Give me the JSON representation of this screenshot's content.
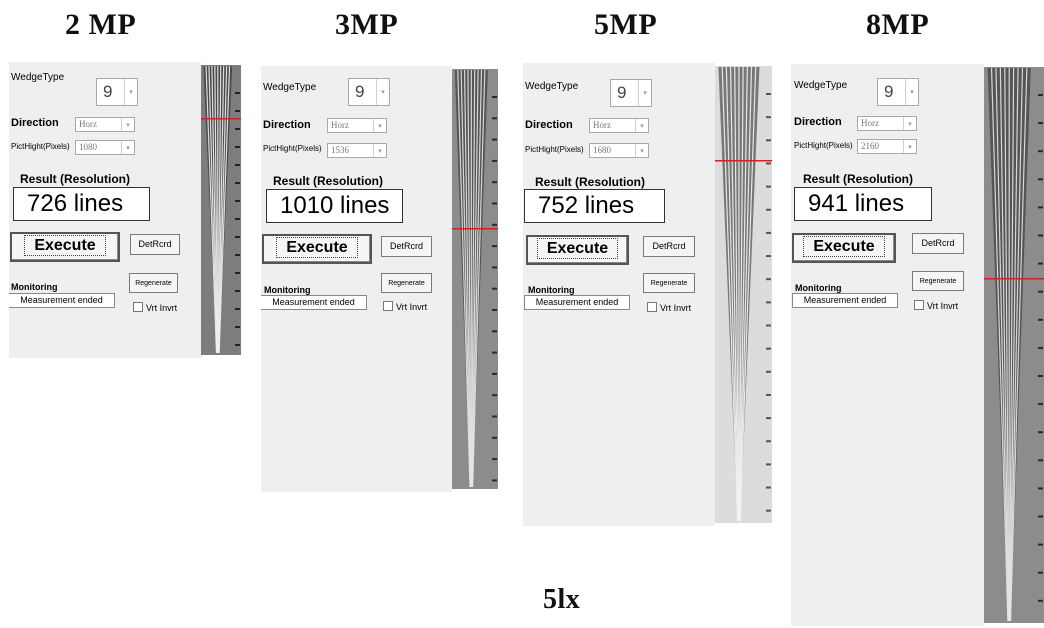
{
  "panels": [
    {
      "title": "2 MP",
      "wedge_type": "9",
      "direction_label": "Direction",
      "direction": "Horz",
      "pict_height": "1080",
      "result_label": "Result (Resolution)",
      "result": "726 lines",
      "execute_label": "Execute",
      "detrcrd_label": "DetRcrd",
      "regenerate_label": "Regenerate",
      "monitoring_label": "Monitoring",
      "monitoring_status": "Measurement ended",
      "vrt_invrt_label": "Vrt Invrt",
      "wedgetype_label": "WedgeType",
      "picthight_label": "PictHight(Pixels)"
    },
    {
      "title": "3MP",
      "wedge_type": "9",
      "direction_label": "Direction",
      "direction": "Horz",
      "pict_height": "1536",
      "result_label": "Result (Resolution)",
      "result": "1010 lines",
      "execute_label": "Execute",
      "detrcrd_label": "DetRcrd",
      "regenerate_label": "Regenerate",
      "monitoring_label": "Monitoring",
      "monitoring_status": "Measurement ended",
      "vrt_invrt_label": "Vrt Invrt",
      "wedgetype_label": "WedgeType",
      "picthight_label": "PictHight(Pixels)"
    },
    {
      "title": "5MP",
      "wedge_type": "9",
      "direction_label": "Direction",
      "direction": "Horz",
      "pict_height": "1680",
      "result_label": "Result (Resolution)",
      "result": "752 lines",
      "execute_label": "Execute",
      "detrcrd_label": "DetRcrd",
      "regenerate_label": "Regenerate",
      "monitoring_label": "Monitoring",
      "monitoring_status": "Measurement ended",
      "vrt_invrt_label": "Vrt Invrt",
      "wedgetype_label": "WedgeType",
      "picthight_label": "PictHight(Pixels)"
    },
    {
      "title": "8MP",
      "wedge_type": "9",
      "direction_label": "Direction",
      "direction": "Horz",
      "pict_height": "2160",
      "result_label": "Result (Resolution)",
      "result": "941 lines",
      "execute_label": "Execute",
      "detrcrd_label": "DetRcrd",
      "regenerate_label": "Regenerate",
      "monitoring_label": "Monitoring",
      "monitoring_status": "Measurement ended",
      "vrt_invrt_label": "Vrt Invrt",
      "wedgetype_label": "WedgeType",
      "picthight_label": "PictHight(Pixels)"
    }
  ],
  "footer_label": "5lx",
  "colors": {
    "marker_line": "#d42020",
    "panel_bg": "#efefef"
  }
}
